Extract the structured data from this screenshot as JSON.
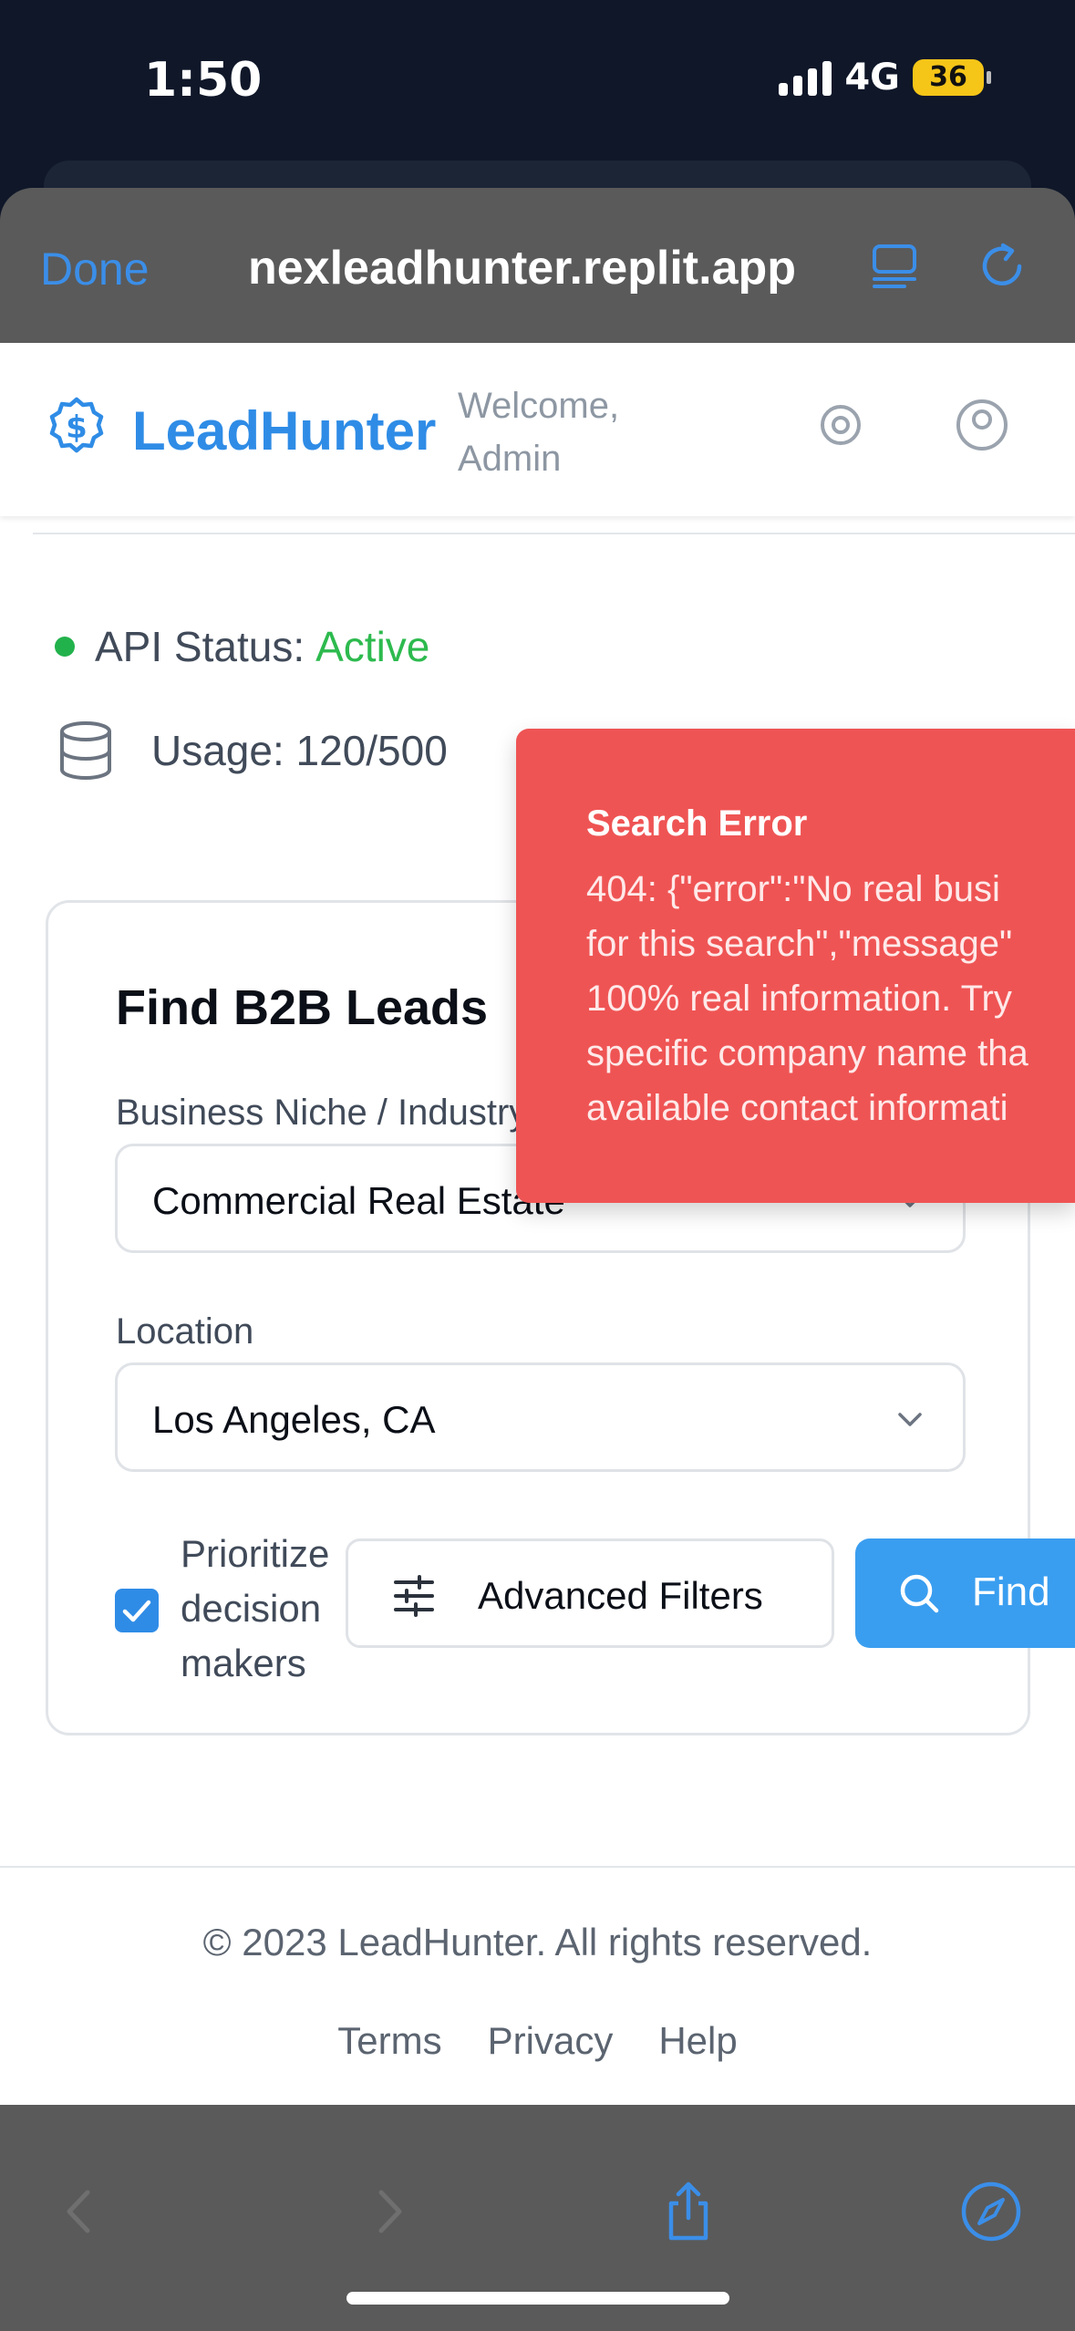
{
  "status_bar": {
    "time": "1:50",
    "network": "4G",
    "battery": "36"
  },
  "browser": {
    "done_label": "Done",
    "url": "nexleadhunter.replit.app"
  },
  "app": {
    "logo_text": "LeadHunter",
    "welcome": "Welcome, Admin"
  },
  "api_status": {
    "label": "API Status:",
    "value": "Active",
    "color": "#2dba4e"
  },
  "usage": {
    "text": "Usage: 120/500"
  },
  "search_form": {
    "title": "Find B2B Leads",
    "niche_label": "Business Niche / Industry",
    "niche_value": "Commercial Real Estate",
    "location_label": "Location",
    "location_value": "Los Angeles, CA",
    "prioritize_label": "Prioritize decision makers",
    "prioritize_checked": true,
    "advanced_filters_label": "Advanced Filters",
    "find_label": "Find"
  },
  "footer": {
    "copyright": "© 2023 LeadHunter. All rights reserved.",
    "links": [
      "Terms",
      "Privacy",
      "Help"
    ]
  },
  "toast": {
    "title": "Search Error",
    "lines": [
      "404: {\"error\":\"No real busi",
      "for this search\",\"message\"",
      "100% real information. Try",
      "specific company name tha",
      "available contact informati"
    ],
    "color": "#ef5454"
  },
  "colors": {
    "accent": "#2f8ce6",
    "button_primary": "#3a9ef0"
  }
}
